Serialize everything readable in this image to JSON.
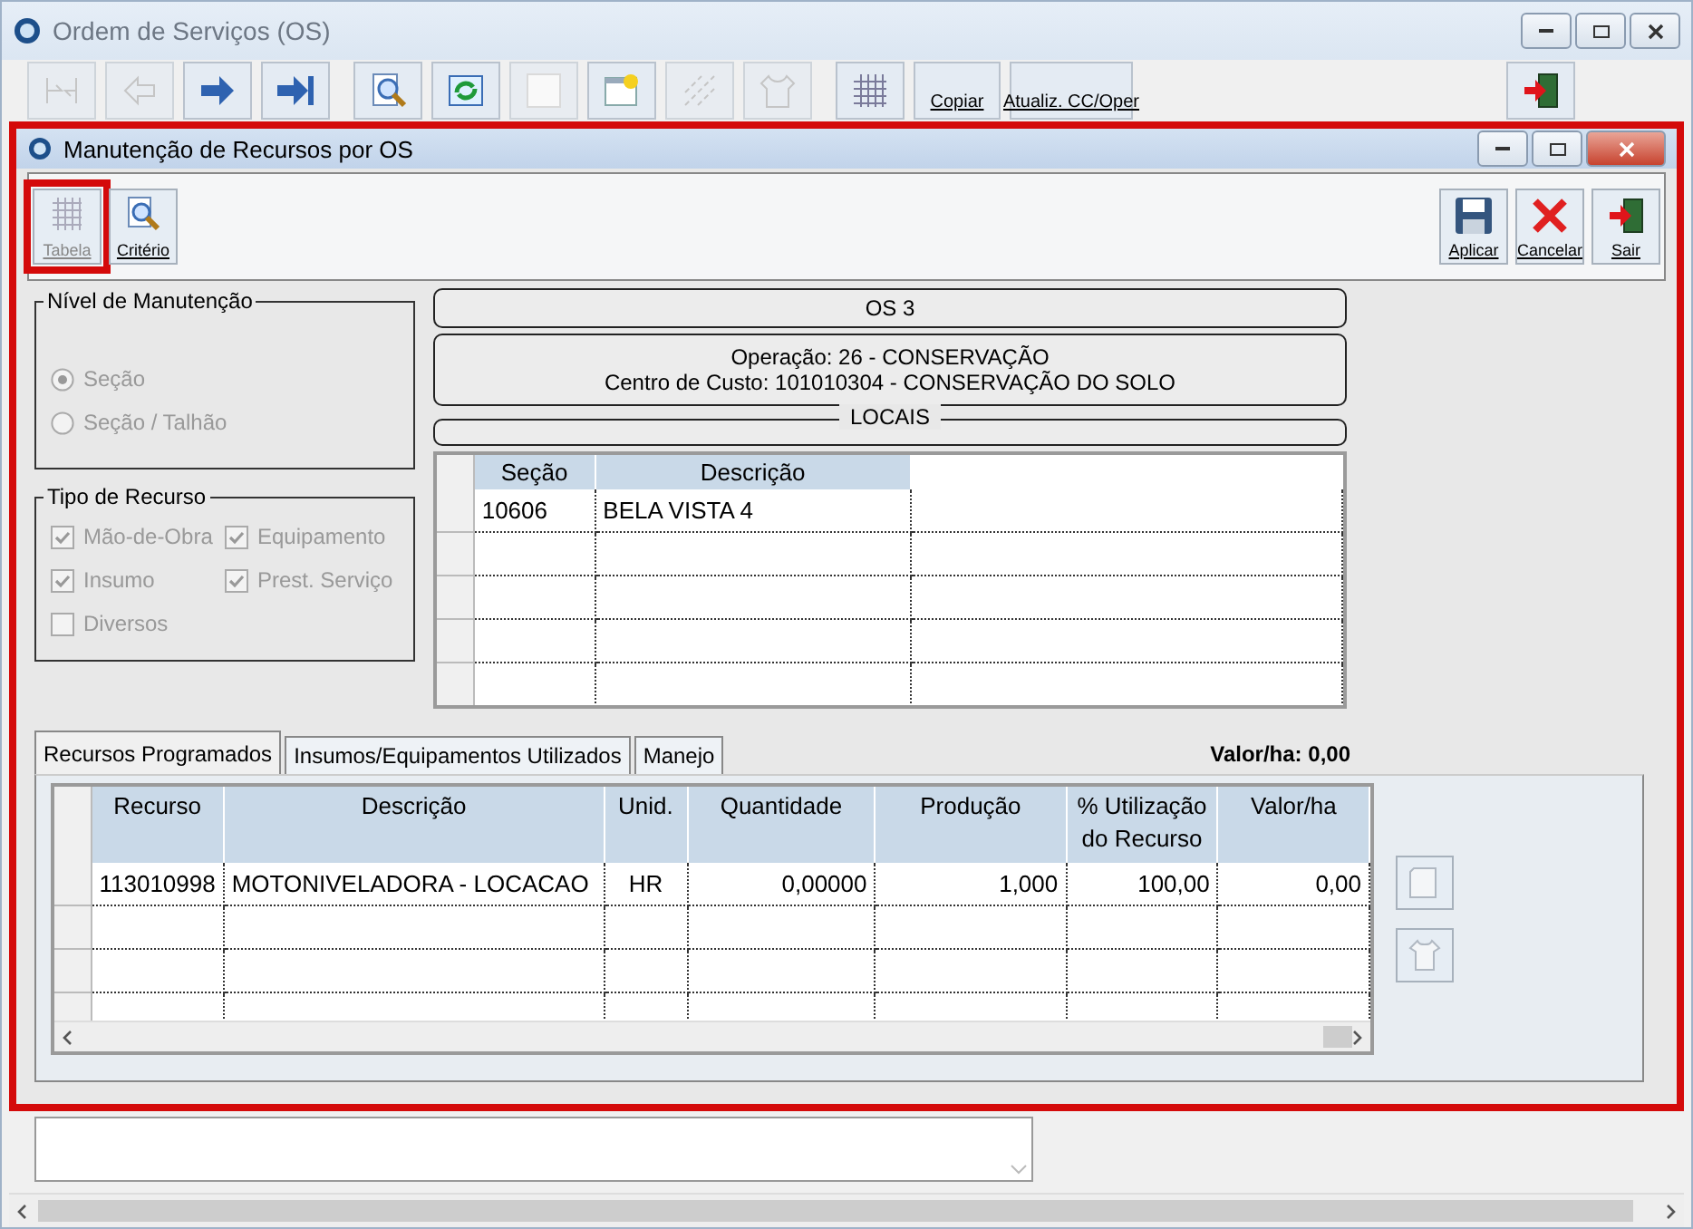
{
  "window": {
    "title": "Ordem de Serviços (OS)"
  },
  "main_toolbar": {
    "buttons": [
      {
        "kind": "icon",
        "disabled": true
      },
      {
        "kind": "icon",
        "disabled": true
      },
      {
        "kind": "icon",
        "disabled": false
      },
      {
        "kind": "icon",
        "disabled": false
      },
      {
        "kind": "icon",
        "disabled": false
      },
      {
        "kind": "icon",
        "disabled": false
      },
      {
        "kind": "icon",
        "disabled": true
      },
      {
        "kind": "icon",
        "disabled": false
      },
      {
        "kind": "icon",
        "disabled": true
      },
      {
        "kind": "icon",
        "disabled": true
      },
      {
        "kind": "icon",
        "disabled": false
      },
      {
        "kind": "text",
        "label": "Copiar",
        "disabled": false
      },
      {
        "kind": "text",
        "label": "Atualiz. CC/Oper",
        "disabled": false
      }
    ],
    "right_buttons": [
      {
        "kind": "icon",
        "disabled": false
      }
    ]
  },
  "dialog": {
    "title": "Manutenção de Recursos por OS",
    "toolbar_left": [
      {
        "label": "Tabela",
        "disabled": true,
        "highlighted": true
      },
      {
        "label": "Critério",
        "disabled": false,
        "highlighted": false
      }
    ],
    "toolbar_right": [
      {
        "label": "Aplicar"
      },
      {
        "label": "Cancelar"
      },
      {
        "label": "Sair"
      }
    ],
    "nivel": {
      "title": "Nível de Manutenção",
      "options": [
        {
          "label": "Seção",
          "selected": true,
          "disabled": true
        },
        {
          "label": "Seção / Talhão",
          "selected": false,
          "disabled": true
        }
      ]
    },
    "tipo": {
      "title": "Tipo de Recurso",
      "options": [
        {
          "label": "Mão-de-Obra",
          "checked": true,
          "disabled": true
        },
        {
          "label": "Equipamento",
          "checked": true,
          "disabled": true
        },
        {
          "label": "Insumo",
          "checked": true,
          "disabled": true
        },
        {
          "label": "Prest. Serviço",
          "checked": true,
          "disabled": true
        },
        {
          "label": "Diversos",
          "checked": false,
          "disabled": true
        }
      ]
    },
    "os_label": "OS 3",
    "operacao": "Operação: 26 - CONSERVAÇÃO",
    "centro_custo": "Centro de Custo: 101010304 - CONSERVAÇÃO DO SOLO",
    "locais": {
      "title": "LOCAIS",
      "columns": [
        "Seção",
        "Descrição"
      ],
      "rows": [
        [
          "10606",
          "BELA VISTA 4"
        ]
      ]
    },
    "tabs": [
      {
        "label": "Recursos Programados",
        "selected": true
      },
      {
        "label": "Insumos/Equipamentos Utilizados",
        "selected": false
      },
      {
        "label": "Manejo",
        "selected": false
      }
    ],
    "valor_ha_label": "Valor/ha:",
    "valor_ha_value": "0,00",
    "recursos": {
      "columns": [
        "Recurso",
        "Descrição",
        "Unid.",
        "Quantidade",
        "Produção",
        "% Utilização do Recurso",
        "Valor/ha"
      ],
      "rows": [
        [
          "113010998",
          "MOTONIVELADORA - LOCACAO",
          "HR",
          "0,00000",
          "1,000",
          "100,00",
          "0,00"
        ]
      ]
    }
  }
}
